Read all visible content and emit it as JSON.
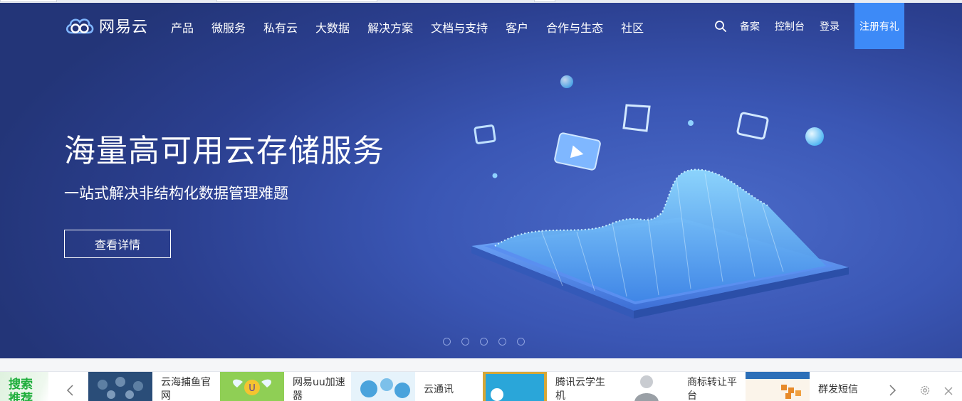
{
  "logo": {
    "text": "网易云",
    "icon": "cloud-logo-icon"
  },
  "nav": {
    "menu": [
      "产品",
      "微服务",
      "私有云",
      "大数据",
      "解决方案",
      "文档与支持",
      "客户",
      "合作与生态",
      "社区"
    ],
    "search_icon": "search-icon",
    "links": [
      "备案",
      "控制台",
      "登录"
    ],
    "register": "注册有礼"
  },
  "hero": {
    "title": "海量高可用云存储服务",
    "subtitle": "一站式解决非结构化数据管理难题",
    "button": "查看详情",
    "slide_count": 5,
    "active_slide": 4,
    "background_color": "#2f4aa0",
    "accent_color": "#3d8af7"
  },
  "recommend": {
    "label": "搜索推荐",
    "items": [
      {
        "text": "云海捕鱼官网",
        "thumb_color": "#2a4d78"
      },
      {
        "text": "网易uu加速器",
        "thumb_color": "#8fcf55"
      },
      {
        "text": "云通讯",
        "thumb_color": "#4aa3dc"
      },
      {
        "text": "腾讯云学生机",
        "thumb_color": "#2aa6d9"
      },
      {
        "text": "商标转让平台",
        "thumb_color": "#9aa0a6"
      },
      {
        "text": "群发短信",
        "thumb_color": "#e78a2a"
      }
    ],
    "label_color": "#1fae3c"
  }
}
